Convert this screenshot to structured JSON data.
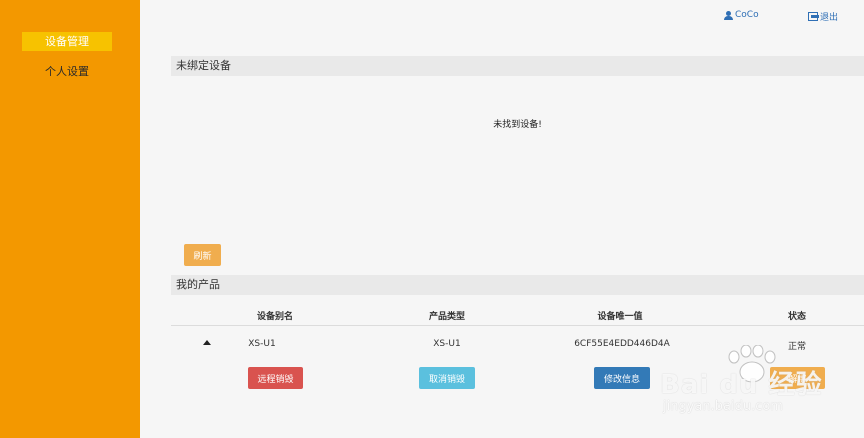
{
  "sidebar": {
    "items": [
      {
        "label": "设备管理",
        "active": true
      },
      {
        "label": "个人设置",
        "active": false
      }
    ]
  },
  "topbar": {
    "user": {
      "icon": "user-icon",
      "label": "CoCo"
    },
    "logout": {
      "icon": "logout-icon",
      "label": "退出"
    }
  },
  "unbound": {
    "title": "未绑定设备",
    "empty_message": "未找到设备!",
    "refresh_label": "刷新"
  },
  "products": {
    "title": "我的产品",
    "columns": [
      "设备别名",
      "产品类型",
      "设备唯一值",
      "状态"
    ],
    "rows": [
      {
        "alias": "XS-U1",
        "type": "XS-U1",
        "uid": "6CF55E4EDD446D4A",
        "status": "正常",
        "actions": [
          "远程销毁",
          "取消销毁",
          "修改信息",
          "解绑"
        ]
      }
    ]
  },
  "watermark": {
    "brand": "Bai du 经验",
    "url": "jingyan.baidu.com"
  },
  "colors": {
    "sidebar": "#f39800",
    "active_nav": "#f7c200",
    "danger": "#d9534f",
    "info": "#5bc0de",
    "primary": "#337ab7",
    "warning": "#f0ad4e"
  }
}
